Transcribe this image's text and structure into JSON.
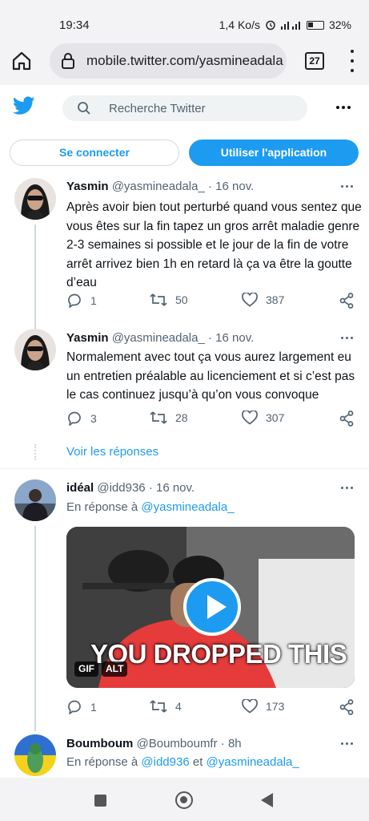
{
  "status_bar": {
    "time": "19:34",
    "speed": "1,4 Ko/s",
    "battery": "32%",
    "network": "4G+"
  },
  "browser": {
    "url": "mobile.twitter.com/yasmineadala",
    "tab_count": "27"
  },
  "twitter_header": {
    "search_placeholder": "Recherche Twitter"
  },
  "auth_buttons": {
    "login": "Se connecter",
    "use_app": "Utiliser l'application"
  },
  "tweets": [
    {
      "name": "Yasmin",
      "handle": "@yasmineadala_",
      "date": "· 16 nov.",
      "text": "Après avoir bien tout perturbé quand vous sentez que vous êtes sur la fin tapez un gros arrêt maladie genre 2-3 semaines si possible et le jour de la fin de votre arrêt arrivez bien 1h en retard là ça va être la goutte d’eau",
      "replies": "1",
      "retweets": "50",
      "likes": "387"
    },
    {
      "name": "Yasmin",
      "handle": "@yasmineadala_",
      "date": "· 16 nov.",
      "text": "Normalement avec tout ça vous aurez largement eu un entretien préalable au licenciement et si c’est pas le cas continuez jusqu’à qu’on vous convoque",
      "replies": "3",
      "retweets": "28",
      "likes": "307"
    },
    {
      "name": "idéal",
      "handle": "@idd936",
      "date": "· 16 nov.",
      "reply_prefix": "En réponse à",
      "reply_to": "@yasmineadala_",
      "media_caption": "YOU DROPPED THIS",
      "badge_gif": "GIF",
      "badge_alt": "ALT",
      "replies": "1",
      "retweets": "4",
      "likes": "173"
    },
    {
      "name": "Boumboum",
      "handle": "@Boumboumfr",
      "date": "· 8h",
      "reply_prefix": "En réponse à",
      "reply_to_1": "@idd936",
      "reply_and": "et",
      "reply_to_2": "@yasmineadala_"
    }
  ],
  "show_replies": "Voir les réponses",
  "colors": {
    "accent": "#1d9bf0",
    "text": "#0f1419",
    "secondary": "#536471"
  }
}
